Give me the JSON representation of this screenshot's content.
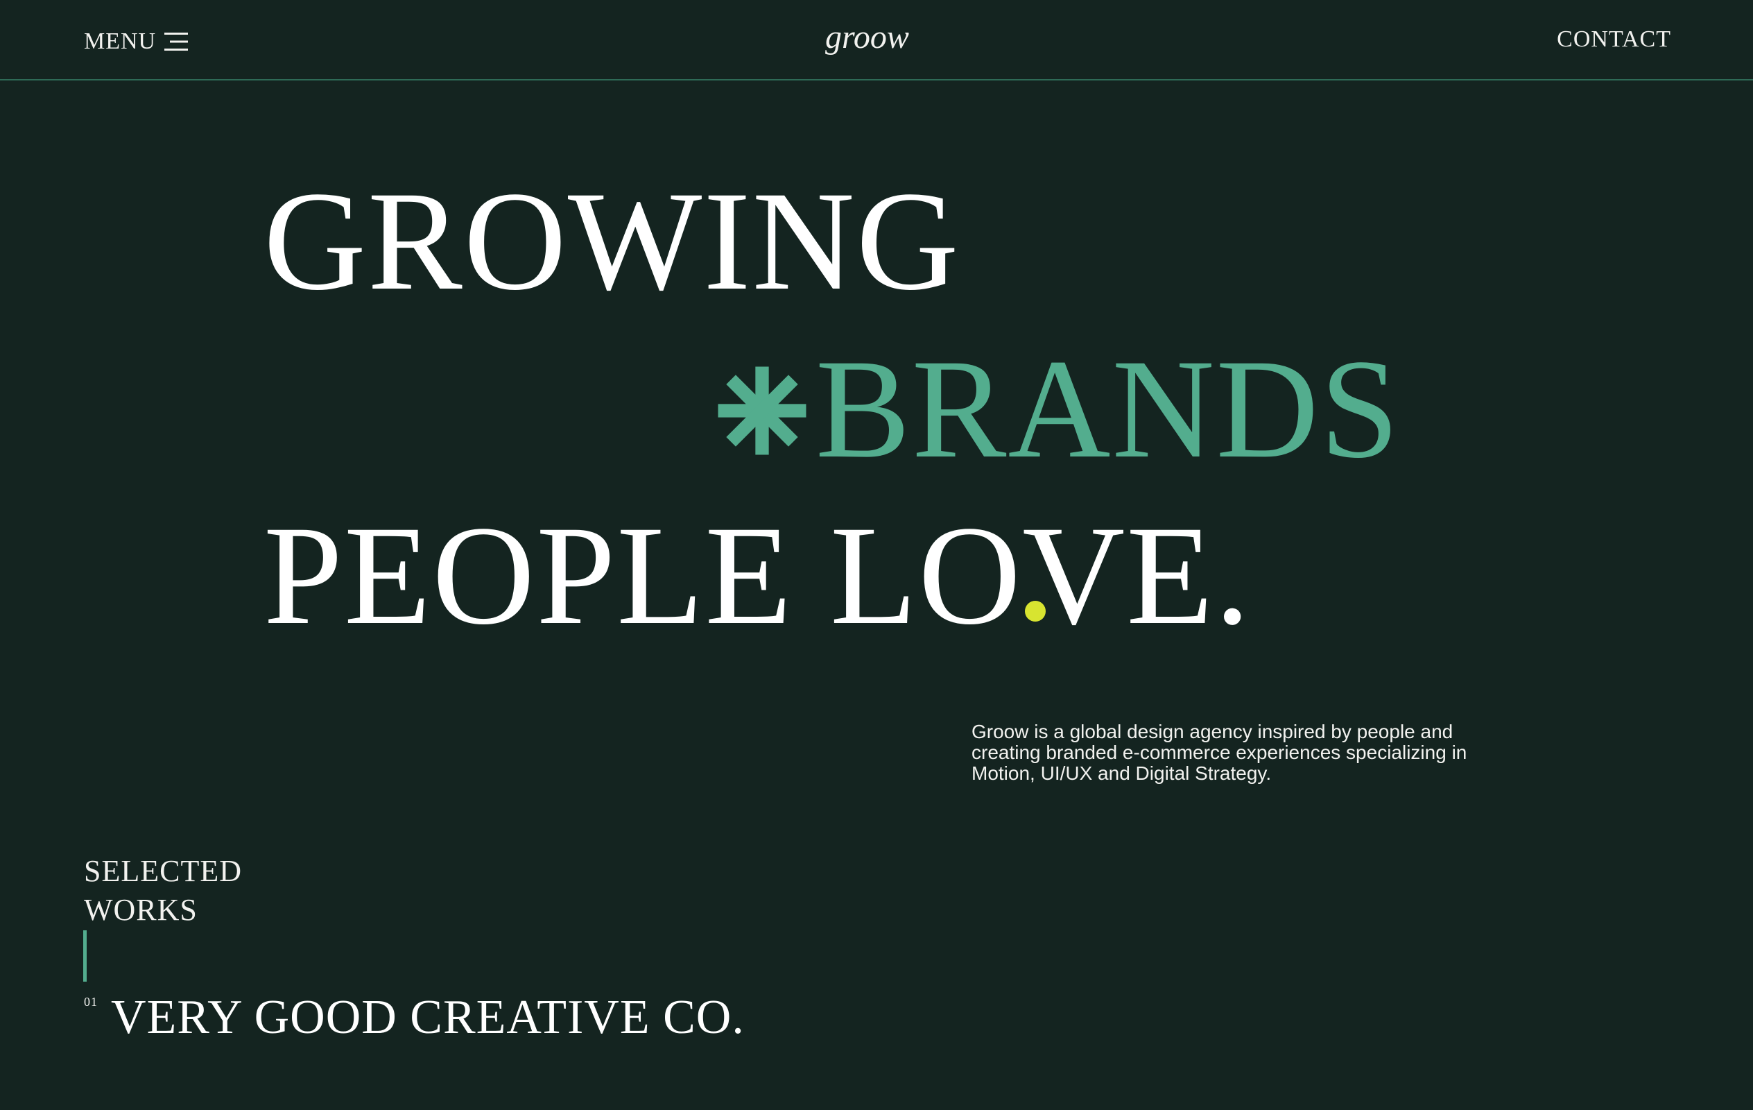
{
  "header": {
    "menu_label": "MENU",
    "logo": "groow",
    "contact_label": "CONTACT"
  },
  "hero": {
    "line1": "GROWING",
    "line2": "BRANDS",
    "line3": "PEOPLE LOVE."
  },
  "tagline": "Groow is a global design agency inspired by people and creating branded e-commerce experiences specializing in Motion, UI/UX and Digital Strategy.",
  "selected_works": {
    "heading_line1": "SELECTED",
    "heading_line2": "WORKS",
    "items": [
      {
        "number": "01",
        "title": "VERY GOOD CREATIVE CO."
      }
    ]
  },
  "colors": {
    "background": "#142420",
    "accent": "#53ad8e",
    "cursor": "#d8e430",
    "text": "#ffffff"
  },
  "icons": {
    "menu": "hamburger-icon",
    "accent": "asterisk-icon"
  }
}
